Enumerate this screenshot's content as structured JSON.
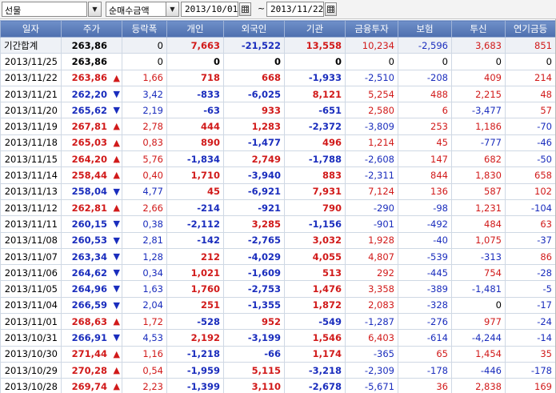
{
  "toolbar": {
    "market_select": "선물",
    "type_select": "순매수금액",
    "start_date": "2013/10/01",
    "end_date": "2013/11/22",
    "date_separator": "~"
  },
  "columns": [
    "일자",
    "주가",
    "등락폭",
    "개인",
    "외국인",
    "기관",
    "금융투자",
    "보험",
    "투신",
    "연기금등"
  ],
  "rows": [
    {
      "date": "기간합계",
      "price": "263,86",
      "pc": "black",
      "arrow": "",
      "change": "0",
      "cc": "black",
      "ind": "7,663",
      "ic": "red",
      "frn": "-21,522",
      "fc": "blue",
      "inst": "13,558",
      "sc": "red",
      "fin": "10,234",
      "fic": "red",
      "ins": "-2,596",
      "isc": "blue",
      "trust": "3,683",
      "tc": "red",
      "pen": "851",
      "pnc": "red",
      "total": true
    },
    {
      "date": "2013/11/25",
      "price": "263,86",
      "pc": "black",
      "arrow": "",
      "change": "0",
      "cc": "black",
      "ind": "0",
      "ic": "black",
      "frn": "0",
      "fc": "black",
      "inst": "0",
      "sc": "black",
      "fin": "0",
      "fic": "black",
      "ins": "0",
      "isc": "black",
      "trust": "0",
      "tc": "black",
      "pen": "0",
      "pnc": "black"
    },
    {
      "date": "2013/11/22",
      "price": "263,86",
      "pc": "red",
      "arrow": "▲",
      "change": "1,66",
      "cc": "red",
      "ind": "718",
      "ic": "red",
      "frn": "668",
      "fc": "red",
      "inst": "-1,933",
      "sc": "blue",
      "fin": "-2,510",
      "fic": "blue",
      "ins": "-208",
      "isc": "blue",
      "trust": "409",
      "tc": "red",
      "pen": "214",
      "pnc": "red"
    },
    {
      "date": "2013/11/21",
      "price": "262,20",
      "pc": "blue",
      "arrow": "▼",
      "change": "3,42",
      "cc": "blue",
      "ind": "-833",
      "ic": "blue",
      "frn": "-6,025",
      "fc": "blue",
      "inst": "8,121",
      "sc": "red",
      "fin": "5,254",
      "fic": "red",
      "ins": "488",
      "isc": "red",
      "trust": "2,215",
      "tc": "red",
      "pen": "48",
      "pnc": "red"
    },
    {
      "date": "2013/11/20",
      "price": "265,62",
      "pc": "blue",
      "arrow": "▼",
      "change": "2,19",
      "cc": "blue",
      "ind": "-63",
      "ic": "blue",
      "frn": "933",
      "fc": "red",
      "inst": "-651",
      "sc": "blue",
      "fin": "2,580",
      "fic": "red",
      "ins": "6",
      "isc": "red",
      "trust": "-3,477",
      "tc": "blue",
      "pen": "57",
      "pnc": "red"
    },
    {
      "date": "2013/11/19",
      "price": "267,81",
      "pc": "red",
      "arrow": "▲",
      "change": "2,78",
      "cc": "red",
      "ind": "444",
      "ic": "red",
      "frn": "1,283",
      "fc": "red",
      "inst": "-2,372",
      "sc": "blue",
      "fin": "-3,809",
      "fic": "blue",
      "ins": "253",
      "isc": "red",
      "trust": "1,186",
      "tc": "red",
      "pen": "-70",
      "pnc": "blue"
    },
    {
      "date": "2013/11/18",
      "price": "265,03",
      "pc": "red",
      "arrow": "▲",
      "change": "0,83",
      "cc": "red",
      "ind": "890",
      "ic": "red",
      "frn": "-1,477",
      "fc": "blue",
      "inst": "496",
      "sc": "red",
      "fin": "1,214",
      "fic": "red",
      "ins": "45",
      "isc": "red",
      "trust": "-777",
      "tc": "blue",
      "pen": "-46",
      "pnc": "blue"
    },
    {
      "date": "2013/11/15",
      "price": "264,20",
      "pc": "red",
      "arrow": "▲",
      "change": "5,76",
      "cc": "red",
      "ind": "-1,834",
      "ic": "blue",
      "frn": "2,749",
      "fc": "red",
      "inst": "-1,788",
      "sc": "blue",
      "fin": "-2,608",
      "fic": "blue",
      "ins": "147",
      "isc": "red",
      "trust": "682",
      "tc": "red",
      "pen": "-50",
      "pnc": "blue"
    },
    {
      "date": "2013/11/14",
      "price": "258,44",
      "pc": "red",
      "arrow": "▲",
      "change": "0,40",
      "cc": "red",
      "ind": "1,710",
      "ic": "red",
      "frn": "-3,940",
      "fc": "blue",
      "inst": "883",
      "sc": "red",
      "fin": "-2,311",
      "fic": "blue",
      "ins": "844",
      "isc": "red",
      "trust": "1,830",
      "tc": "red",
      "pen": "658",
      "pnc": "red"
    },
    {
      "date": "2013/11/13",
      "price": "258,04",
      "pc": "blue",
      "arrow": "▼",
      "change": "4,77",
      "cc": "blue",
      "ind": "45",
      "ic": "red",
      "frn": "-6,921",
      "fc": "blue",
      "inst": "7,931",
      "sc": "red",
      "fin": "7,124",
      "fic": "red",
      "ins": "136",
      "isc": "red",
      "trust": "587",
      "tc": "red",
      "pen": "102",
      "pnc": "red"
    },
    {
      "date": "2013/11/12",
      "price": "262,81",
      "pc": "red",
      "arrow": "▲",
      "change": "2,66",
      "cc": "red",
      "ind": "-214",
      "ic": "blue",
      "frn": "-921",
      "fc": "blue",
      "inst": "790",
      "sc": "red",
      "fin": "-290",
      "fic": "blue",
      "ins": "-98",
      "isc": "blue",
      "trust": "1,231",
      "tc": "red",
      "pen": "-104",
      "pnc": "blue"
    },
    {
      "date": "2013/11/11",
      "price": "260,15",
      "pc": "blue",
      "arrow": "▼",
      "change": "0,38",
      "cc": "blue",
      "ind": "-2,112",
      "ic": "blue",
      "frn": "3,285",
      "fc": "red",
      "inst": "-1,156",
      "sc": "blue",
      "fin": "-901",
      "fic": "blue",
      "ins": "-492",
      "isc": "blue",
      "trust": "484",
      "tc": "red",
      "pen": "63",
      "pnc": "red"
    },
    {
      "date": "2013/11/08",
      "price": "260,53",
      "pc": "blue",
      "arrow": "▼",
      "change": "2,81",
      "cc": "blue",
      "ind": "-142",
      "ic": "blue",
      "frn": "-2,765",
      "fc": "blue",
      "inst": "3,032",
      "sc": "red",
      "fin": "1,928",
      "fic": "red",
      "ins": "-40",
      "isc": "blue",
      "trust": "1,075",
      "tc": "red",
      "pen": "-37",
      "pnc": "blue"
    },
    {
      "date": "2013/11/07",
      "price": "263,34",
      "pc": "blue",
      "arrow": "▼",
      "change": "1,28",
      "cc": "blue",
      "ind": "212",
      "ic": "red",
      "frn": "-4,029",
      "fc": "blue",
      "inst": "4,055",
      "sc": "red",
      "fin": "4,807",
      "fic": "red",
      "ins": "-539",
      "isc": "blue",
      "trust": "-313",
      "tc": "blue",
      "pen": "86",
      "pnc": "red"
    },
    {
      "date": "2013/11/06",
      "price": "264,62",
      "pc": "blue",
      "arrow": "▼",
      "change": "0,34",
      "cc": "blue",
      "ind": "1,021",
      "ic": "red",
      "frn": "-1,609",
      "fc": "blue",
      "inst": "513",
      "sc": "red",
      "fin": "292",
      "fic": "red",
      "ins": "-445",
      "isc": "blue",
      "trust": "754",
      "tc": "red",
      "pen": "-28",
      "pnc": "blue"
    },
    {
      "date": "2013/11/05",
      "price": "264,96",
      "pc": "blue",
      "arrow": "▼",
      "change": "1,63",
      "cc": "blue",
      "ind": "1,760",
      "ic": "red",
      "frn": "-2,753",
      "fc": "blue",
      "inst": "1,476",
      "sc": "red",
      "fin": "3,358",
      "fic": "red",
      "ins": "-389",
      "isc": "blue",
      "trust": "-1,481",
      "tc": "blue",
      "pen": "-5",
      "pnc": "blue"
    },
    {
      "date": "2013/11/04",
      "price": "266,59",
      "pc": "blue",
      "arrow": "▼",
      "change": "2,04",
      "cc": "blue",
      "ind": "251",
      "ic": "red",
      "frn": "-1,355",
      "fc": "blue",
      "inst": "1,872",
      "sc": "red",
      "fin": "2,083",
      "fic": "red",
      "ins": "-328",
      "isc": "blue",
      "trust": "0",
      "tc": "black",
      "pen": "-17",
      "pnc": "blue"
    },
    {
      "date": "2013/11/01",
      "price": "268,63",
      "pc": "red",
      "arrow": "▲",
      "change": "1,72",
      "cc": "red",
      "ind": "-528",
      "ic": "blue",
      "frn": "952",
      "fc": "red",
      "inst": "-549",
      "sc": "blue",
      "fin": "-1,287",
      "fic": "blue",
      "ins": "-276",
      "isc": "blue",
      "trust": "977",
      "tc": "red",
      "pen": "-24",
      "pnc": "blue"
    },
    {
      "date": "2013/10/31",
      "price": "266,91",
      "pc": "blue",
      "arrow": "▼",
      "change": "4,53",
      "cc": "blue",
      "ind": "2,192",
      "ic": "red",
      "frn": "-3,199",
      "fc": "blue",
      "inst": "1,546",
      "sc": "red",
      "fin": "6,403",
      "fic": "red",
      "ins": "-614",
      "isc": "blue",
      "trust": "-4,244",
      "tc": "blue",
      "pen": "-14",
      "pnc": "blue"
    },
    {
      "date": "2013/10/30",
      "price": "271,44",
      "pc": "red",
      "arrow": "▲",
      "change": "1,16",
      "cc": "red",
      "ind": "-1,218",
      "ic": "blue",
      "frn": "-66",
      "fc": "blue",
      "inst": "1,174",
      "sc": "red",
      "fin": "-365",
      "fic": "blue",
      "ins": "65",
      "isc": "red",
      "trust": "1,454",
      "tc": "red",
      "pen": "35",
      "pnc": "red"
    },
    {
      "date": "2013/10/29",
      "price": "270,28",
      "pc": "red",
      "arrow": "▲",
      "change": "0,54",
      "cc": "red",
      "ind": "-1,959",
      "ic": "blue",
      "frn": "5,115",
      "fc": "red",
      "inst": "-3,218",
      "sc": "blue",
      "fin": "-2,309",
      "fic": "blue",
      "ins": "-178",
      "isc": "blue",
      "trust": "-446",
      "tc": "blue",
      "pen": "-178",
      "pnc": "blue"
    },
    {
      "date": "2013/10/28",
      "price": "269,74",
      "pc": "red",
      "arrow": "▲",
      "change": "2,23",
      "cc": "red",
      "ind": "-1,399",
      "ic": "blue",
      "frn": "3,110",
      "fc": "red",
      "inst": "-2,678",
      "sc": "blue",
      "fin": "-5,671",
      "fic": "blue",
      "ins": "36",
      "isc": "red",
      "trust": "2,838",
      "tc": "red",
      "pen": "169",
      "pnc": "red"
    }
  ]
}
